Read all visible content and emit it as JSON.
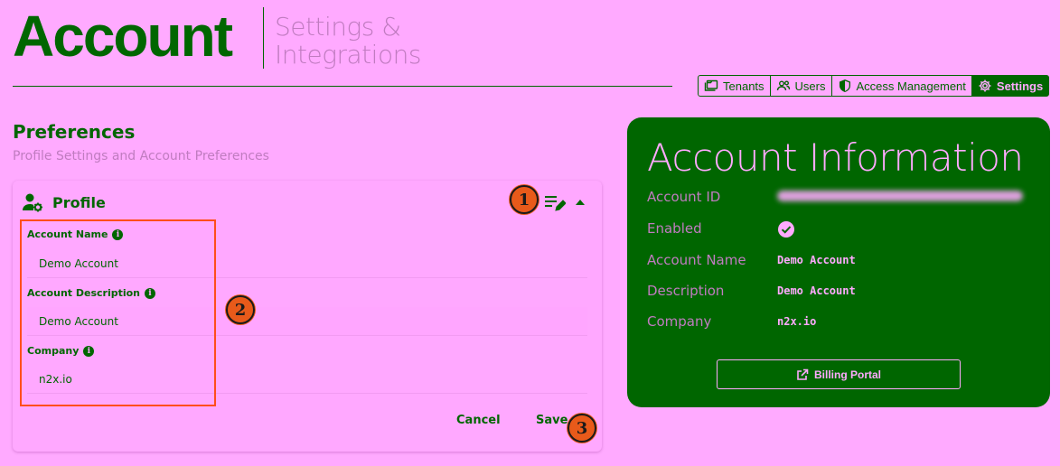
{
  "header": {
    "title": "Account",
    "subtitle_line1": "Settings &",
    "subtitle_line2": "Integrations"
  },
  "nav": {
    "tabs": [
      {
        "label": "Tenants",
        "icon": "folders-icon",
        "active": false
      },
      {
        "label": "Users",
        "icon": "users-icon",
        "active": false
      },
      {
        "label": "Access Management",
        "icon": "shield-icon",
        "active": false
      },
      {
        "label": "Settings",
        "icon": "gear-icon",
        "active": true
      }
    ]
  },
  "preferences": {
    "title": "Preferences",
    "subtitle": "Profile Settings and Account Preferences"
  },
  "profile": {
    "title": "Profile",
    "fields": [
      {
        "label": "Account Name",
        "value": "Demo Account"
      },
      {
        "label": "Account Description",
        "value": "Demo Account"
      },
      {
        "label": "Company",
        "value": "n2x.io"
      }
    ],
    "cancel_label": "Cancel",
    "save_label": "Save"
  },
  "annotations": [
    "1",
    "2",
    "3"
  ],
  "account_info": {
    "title": "Account Information",
    "rows": [
      {
        "label": "Account ID",
        "value": ""
      },
      {
        "label": "Enabled",
        "value": ""
      },
      {
        "label": "Account Name",
        "value": "Demo Account"
      },
      {
        "label": "Description",
        "value": "Demo Account"
      },
      {
        "label": "Company",
        "value": "n2x.io"
      }
    ],
    "billing_label": "Billing Portal"
  },
  "colors": {
    "background": "#ffaaff",
    "primary": "#006600",
    "muted": "#c07cc0",
    "annotation": "#e85a1a"
  }
}
